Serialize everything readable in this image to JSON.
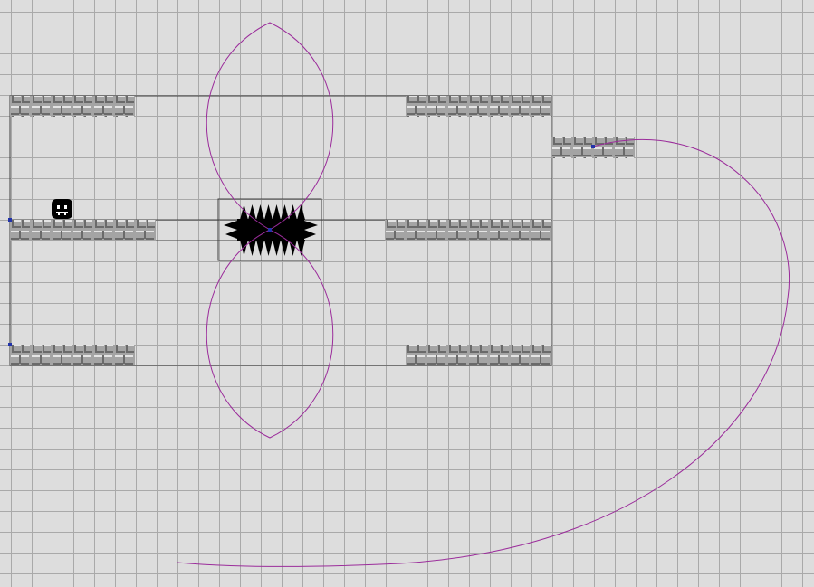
{
  "level": {
    "background_color": "#dddddd",
    "grid_line_color": "#a9a9a9",
    "block_color": "#a4a4a4",
    "block_highlight_color": "#e4e4e4",
    "block_shadow_color": "#6a6a6a",
    "path_color": "#9b2c9b",
    "bounding_box_color": "#3f3f3f",
    "anchor_color": "#2233aa",
    "player_color": "#000000",
    "spike_color": "#000000"
  },
  "entities": {
    "player": {
      "type": "player",
      "icon": "smiley-face-icon"
    },
    "hazard": {
      "type": "spike-mine",
      "icon": "spike-icon"
    },
    "platforms": [
      {
        "id": "platform-top-left",
        "tiles": 6
      },
      {
        "id": "platform-top-right",
        "tiles": 7
      },
      {
        "id": "platform-middle-left",
        "tiles": 7
      },
      {
        "id": "platform-middle-right",
        "tiles": 8
      },
      {
        "id": "platform-bottom-left",
        "tiles": 6
      },
      {
        "id": "platform-bottom-right",
        "tiles": 7
      },
      {
        "id": "platform-moving",
        "tiles": 4
      }
    ]
  }
}
